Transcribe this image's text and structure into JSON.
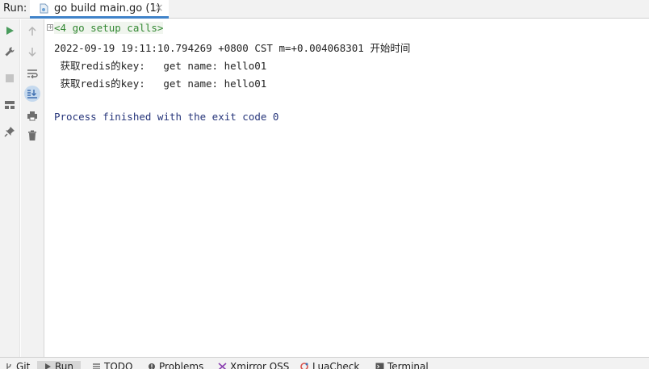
{
  "header": {
    "run_label": "Run:",
    "tab": {
      "label": "go build main.go (1)",
      "close": "×"
    }
  },
  "toolbar_left": [
    {
      "name": "rerun",
      "icon": "play-icon",
      "color": "#4a9c5d"
    },
    {
      "name": "settings",
      "icon": "wrench-icon"
    },
    {
      "name": "stop",
      "icon": "stop-icon",
      "disabled": true
    },
    {
      "name": "layout",
      "icon": "layout-icon"
    },
    {
      "name": "pin",
      "icon": "pin-icon"
    }
  ],
  "toolbar_inner": [
    {
      "name": "up",
      "icon": "arrow-up-icon",
      "disabled": true
    },
    {
      "name": "down",
      "icon": "arrow-down-icon",
      "disabled": true
    },
    {
      "name": "soft-wrap",
      "icon": "soft-wrap-icon"
    },
    {
      "name": "scroll-to-end",
      "icon": "scroll-to-end-icon",
      "active": true
    },
    {
      "name": "print",
      "icon": "print-icon"
    },
    {
      "name": "clear",
      "icon": "trash-icon"
    }
  ],
  "console": {
    "fold_symbol": "+",
    "setup_calls": "<4 go setup calls>",
    "lines": [
      "2022-09-19 19:11:10.794269 +0800 CST m=+0.004068301 开始时间",
      " 获取redis的key:   get name: hello01",
      " 获取redis的key:   get name: hello01",
      "",
      "Process finished with the exit code 0"
    ]
  },
  "bottom_tabs": [
    {
      "label": "Git",
      "icon": "git-branch-icon"
    },
    {
      "label": "Run",
      "icon": "run-icon",
      "selected": true
    },
    {
      "label": "TODO",
      "icon": "list-icon"
    },
    {
      "label": "Problems",
      "icon": "problems-icon"
    },
    {
      "label": "Xmirror OSS",
      "icon": "xmirror-icon"
    },
    {
      "label": "LuaCheck",
      "icon": "luacheck-icon"
    },
    {
      "label": "Terminal",
      "icon": "terminal-icon"
    }
  ],
  "colors": {
    "accent": "#4083c9",
    "setup_green": "#338833",
    "exit_blue": "#26357a"
  }
}
